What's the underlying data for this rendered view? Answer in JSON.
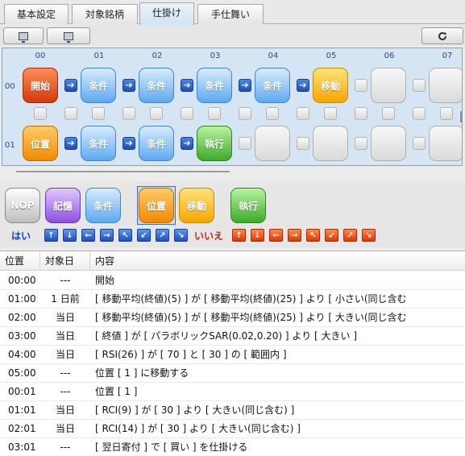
{
  "tabs": [
    {
      "label": "基本設定",
      "active": false
    },
    {
      "label": "対象銘柄",
      "active": false
    },
    {
      "label": "仕掛け",
      "active": true
    },
    {
      "label": "手仕舞い",
      "active": false
    }
  ],
  "toolbar": {
    "left_icons": [
      "monitor-icon",
      "monitor-icon"
    ],
    "right_icon": "refresh-icon"
  },
  "flow": {
    "columns": [
      "00",
      "01",
      "02",
      "03",
      "04",
      "05",
      "06",
      "07"
    ],
    "rows": [
      "00",
      "01"
    ],
    "row0": [
      "開始",
      "条件",
      "条件",
      "条件",
      "条件",
      "移動"
    ],
    "row1": [
      "位置",
      "条件",
      "条件",
      "執行"
    ]
  },
  "palette": {
    "nop": "NOP",
    "memory": "記憶",
    "condition": "条件",
    "position": "位置",
    "move": "移動",
    "execute": "執行",
    "yes_label": "はい",
    "no_label": "いいえ",
    "directions": [
      "up",
      "down",
      "left",
      "right",
      "up-left",
      "down-left",
      "up-right",
      "down-right"
    ]
  },
  "table": {
    "headers": [
      "位置",
      "対象日",
      "内容"
    ],
    "rows": [
      [
        "00:00",
        "---",
        "開始"
      ],
      [
        "01:00",
        "1 日前",
        "[ 移動平均(終値)(5) ] が [ 移動平均(終値)(25) ] より [ 小さい(同じ含む"
      ],
      [
        "02:00",
        "当日",
        "[ 移動平均(終値)(5) ] が [ 移動平均(終値)(25) ] より [ 大きい(同じ含む"
      ],
      [
        "03:00",
        "当日",
        "[ 終値 ] が [ パラボリックSAR(0.02,0.20) ] より [ 大きい ]"
      ],
      [
        "04:00",
        "当日",
        "[ RSI(26) ] が [ 70 ] と [ 30 ] の [ 範囲内 ]"
      ],
      [
        "05:00",
        "---",
        "位置 [ 1 ] に移動する"
      ],
      [
        "00:01",
        "---",
        "位置 [ 1 ]"
      ],
      [
        "01:01",
        "当日",
        "[ RCI(9) ] が [ 30 ] より [ 大きい(同じ含む) ]"
      ],
      [
        "02:01",
        "当日",
        "[ RCI(14) ] が [ 30 ] より [ 大きい(同じ含む) ]"
      ],
      [
        "03:01",
        "---",
        "[ 翌日寄付 ] で [ 買い ] を仕掛ける"
      ]
    ]
  }
}
